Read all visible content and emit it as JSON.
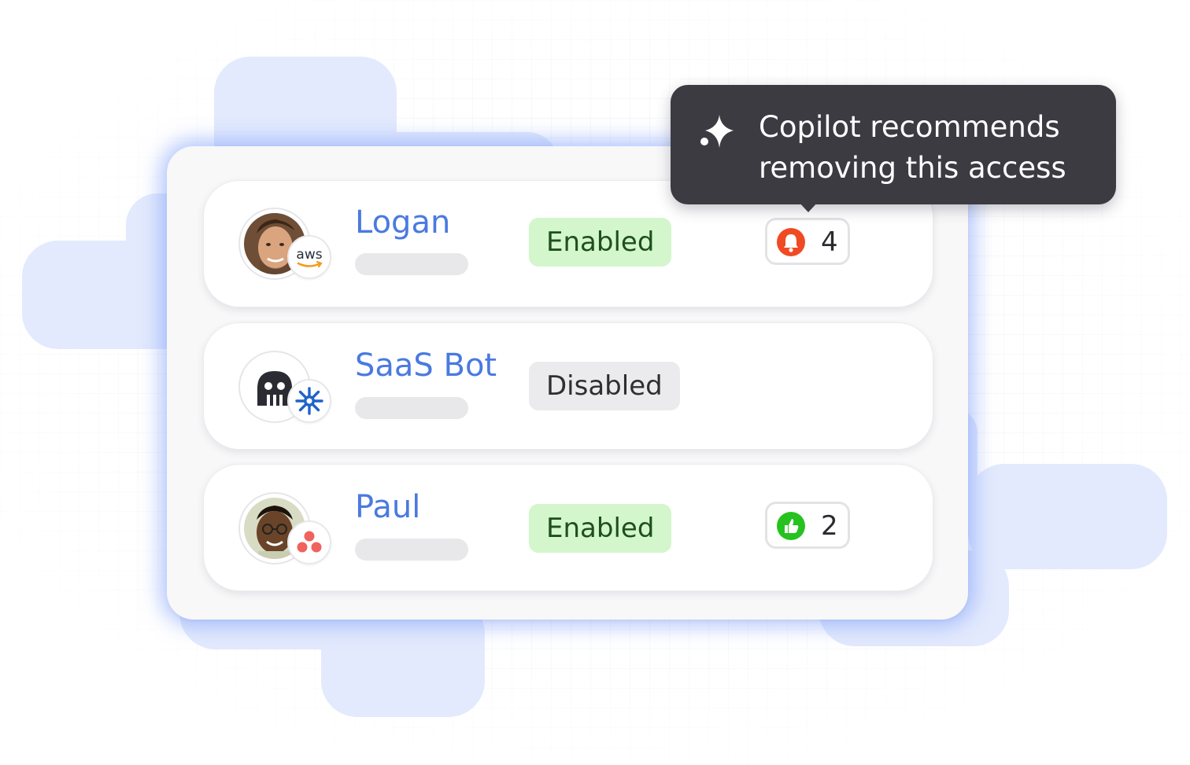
{
  "tooltip": {
    "text": "Copilot recommends removing this access",
    "icon": "sparkle-icon"
  },
  "rows": [
    {
      "name": "Logan",
      "avatar": "person-photo",
      "app_badge": "aws-logo",
      "app_badge_text": "aws",
      "status": "Enabled",
      "alert": {
        "icon": "bell-icon",
        "color": "#f04a23",
        "count": "4"
      }
    },
    {
      "name": "SaaS Bot",
      "avatar": "bot-icon",
      "app_badge": "snowflake-logo",
      "status": "Disabled"
    },
    {
      "name": "Paul",
      "avatar": "person-photo",
      "app_badge": "asana-logo",
      "status": "Enabled",
      "alert": {
        "icon": "thumbs-up-icon",
        "color": "#26c21f",
        "count": "2"
      }
    }
  ],
  "colors": {
    "name": "#4a7ae0",
    "enabled_bg": "#d3f6cc",
    "disabled_bg": "#ebebed",
    "tooltip_bg": "#3c3b42",
    "glow": "#7498fa"
  }
}
